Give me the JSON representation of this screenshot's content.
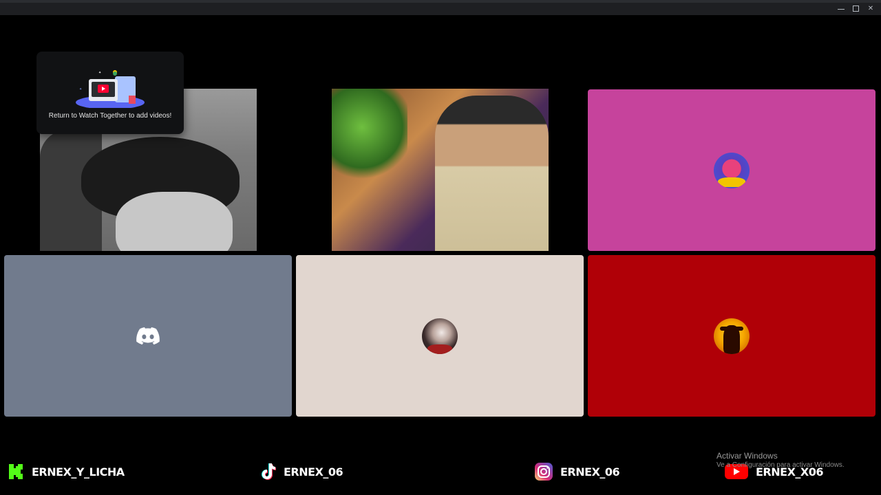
{
  "window": {
    "controls": [
      "minimize",
      "maximize",
      "close"
    ]
  },
  "popup": {
    "text": "Return to Watch Together to add videos!",
    "icon": "watch-together-icon"
  },
  "tiles": [
    {
      "kind": "camera",
      "color": "#555555"
    },
    {
      "kind": "camera",
      "color": "#555555"
    },
    {
      "kind": "avatar",
      "color": "#c6439c"
    },
    {
      "kind": "discord-default",
      "color": "#717b8d"
    },
    {
      "kind": "avatar",
      "color": "#e1d6cf"
    },
    {
      "kind": "avatar",
      "color": "#b00007"
    }
  ],
  "socials": [
    {
      "platform": "kick",
      "icon": "kick-icon",
      "handle": "ERNEX_Y_LICHA",
      "color": "#53fc18"
    },
    {
      "platform": "tiktok",
      "icon": "tiktok-icon",
      "handle": "ERNEX_06"
    },
    {
      "platform": "instagram",
      "icon": "instagram-icon",
      "handle": "ERNEX_06"
    },
    {
      "platform": "youtube",
      "icon": "youtube-icon",
      "handle": "ERNEX_X06",
      "color": "#ff0000"
    }
  ],
  "windows_activation": {
    "title": "Activar Windows",
    "subtitle": "Ve a Configuración para activar Windows."
  }
}
